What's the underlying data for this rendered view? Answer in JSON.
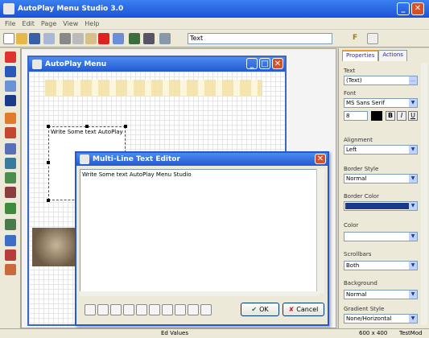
{
  "window": {
    "title": "AutoPlay Menu Studio 3.0"
  },
  "menu": [
    "File",
    "Edit",
    "Page",
    "View",
    "Help"
  ],
  "toolbar": {
    "font_value": "Text",
    "font_size": "F"
  },
  "canvas_window": {
    "title": "AutoPlay Menu",
    "text_object": "Write Some text AutoPlay"
  },
  "dialog": {
    "title": "Multi-Line Text Editor",
    "content": "Write Some text AutoPlay Menu Studio",
    "ok_label": "OK",
    "cancel_label": "Cancel"
  },
  "panel": {
    "tabs": [
      "Properties",
      "Actions"
    ],
    "fields": [
      {
        "label": "Text",
        "value": "(Text)"
      },
      {
        "label": "Font",
        "value": "MS Sans Serif"
      },
      {
        "label": "Alignment",
        "value": "Left"
      },
      {
        "label": "Border Style",
        "value": "Normal"
      },
      {
        "label": "Border Color",
        "value": ""
      },
      {
        "label": "Color",
        "value": ""
      },
      {
        "label": "Scrollbars",
        "value": "Both"
      },
      {
        "label": "Background",
        "value": "Normal"
      },
      {
        "label": "Gradient Style",
        "value": "None/Horizontal"
      }
    ],
    "font_size": "8"
  },
  "status": {
    "center": "Ed Values",
    "right1": "600 x 400",
    "right2": "TestMod"
  },
  "colors": {
    "title": "#2458d0",
    "accent": "#1c3a8c"
  }
}
